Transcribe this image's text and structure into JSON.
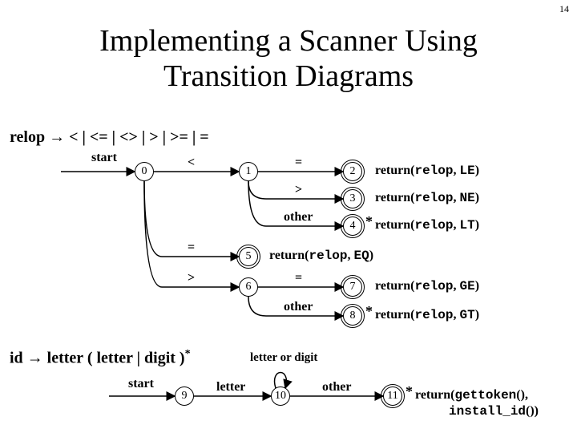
{
  "page_number": "14",
  "title_line1": "Implementing a Scanner Using",
  "title_line2": "Transition Diagrams",
  "grammar": {
    "relop": "relop → < | <= | <> | > | >= | =",
    "id_prefix": "id → letter ( letter | digit )",
    "id_star": "*"
  },
  "labels": {
    "start": "start",
    "lt": "<",
    "eq": "=",
    "gt": ">",
    "other": "other",
    "letter": "letter",
    "letter_or_digit": "letter or digit"
  },
  "nodes": {
    "n0": "0",
    "n1": "1",
    "n2": "2",
    "n3": "3",
    "n4": "4",
    "n5": "5",
    "n6": "6",
    "n7": "7",
    "n8": "8",
    "n9": "9",
    "n10": "10",
    "n11": "11"
  },
  "returns": {
    "r2": "return(relop, LE)",
    "r3": "return(relop, NE)",
    "r4": "return(relop, LT)",
    "r5": "return(relop, EQ)",
    "r6": "return(relop, GE)",
    "r7": "return(relop, GT)",
    "r8_a": "return(gettoken(),",
    "r8_b": "install_id())"
  },
  "chart_data": {
    "type": "diagram",
    "automata": [
      {
        "name": "relop",
        "start": 0,
        "states": [
          0,
          1,
          2,
          3,
          4,
          5,
          6,
          7,
          8
        ],
        "accepting": [
          2,
          3,
          4,
          5,
          7,
          8
        ],
        "retract_marker": [
          4,
          8
        ],
        "transitions": [
          {
            "from": 0,
            "to": 1,
            "label": "<"
          },
          {
            "from": 0,
            "to": 5,
            "label": "="
          },
          {
            "from": 0,
            "to": 6,
            "label": ">"
          },
          {
            "from": 1,
            "to": 2,
            "label": "="
          },
          {
            "from": 1,
            "to": 3,
            "label": ">"
          },
          {
            "from": 1,
            "to": 4,
            "label": "other"
          },
          {
            "from": 6,
            "to": 7,
            "label": "="
          },
          {
            "from": 6,
            "to": 8,
            "label": "other"
          }
        ],
        "actions": {
          "2": "return(relop, LE)",
          "3": "return(relop, NE)",
          "4": "return(relop, LT)",
          "5": "return(relop, EQ)",
          "7": "return(relop, GE)",
          "8": "return(relop, GT)"
        }
      },
      {
        "name": "id",
        "start": 9,
        "states": [
          9,
          10,
          11
        ],
        "accepting": [
          11
        ],
        "retract_marker": [
          11
        ],
        "transitions": [
          {
            "from": 9,
            "to": 10,
            "label": "letter"
          },
          {
            "from": 10,
            "to": 10,
            "label": "letter or digit"
          },
          {
            "from": 10,
            "to": 11,
            "label": "other"
          }
        ],
        "actions": {
          "11": "return(gettoken(), install_id())"
        }
      }
    ]
  }
}
